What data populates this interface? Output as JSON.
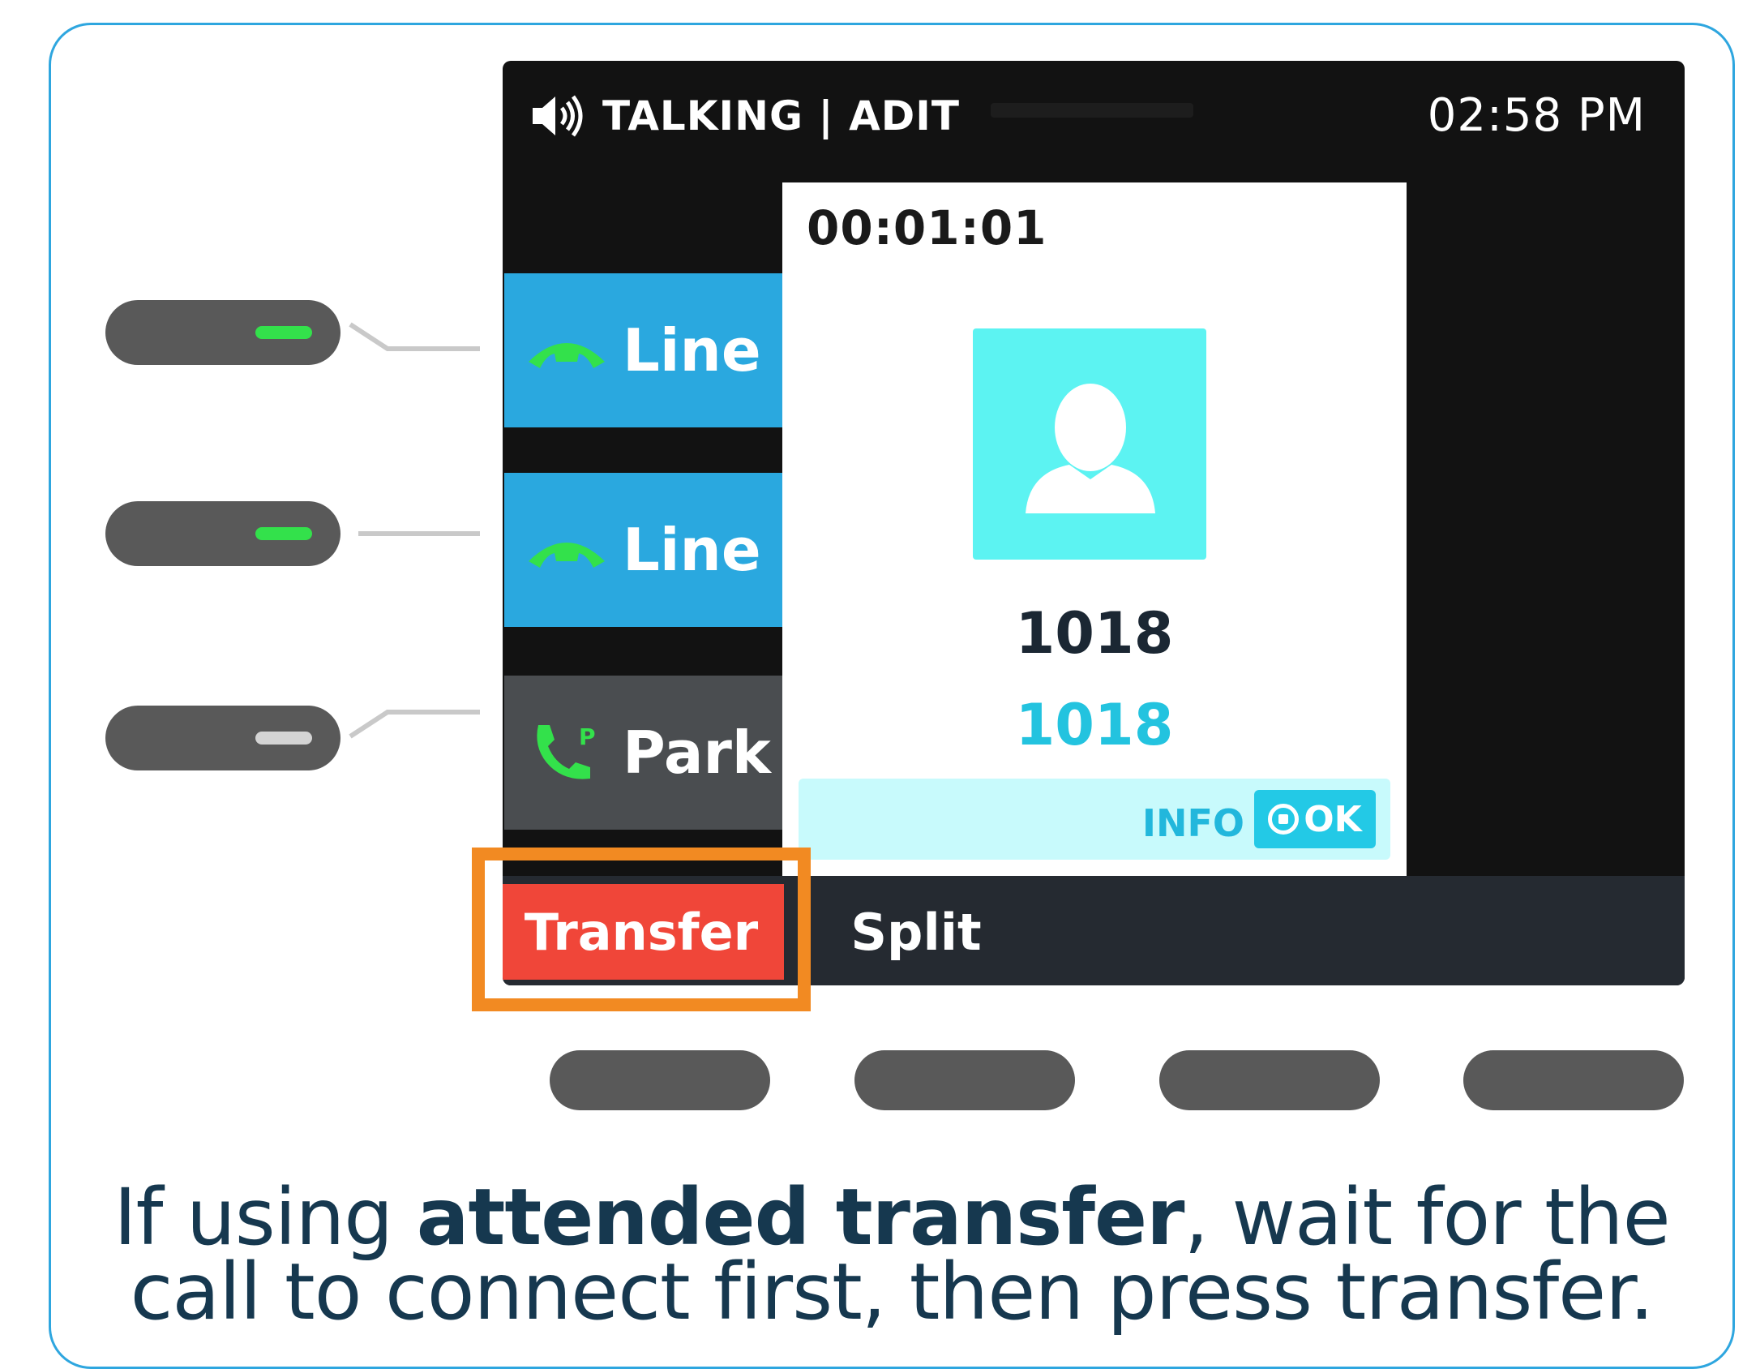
{
  "status": {
    "title": "TALKING | ADIT",
    "time": "02:58 PM"
  },
  "line_keys": [
    {
      "label": "Line",
      "icon": "handset-icon"
    },
    {
      "label": "Line",
      "icon": "handset-icon"
    },
    {
      "label": "Park",
      "icon": "park-call-icon"
    }
  ],
  "popup": {
    "timer": "00:01:01",
    "caller_name": "1018",
    "caller_number": "1018",
    "info_label": "INFO",
    "ok_label": "OK"
  },
  "softkeys": {
    "transfer": "Transfer",
    "split": "Split"
  },
  "caption": {
    "line1_pre": "If using ",
    "line1_bold": "attended transfer",
    "line1_post": ", wait for the",
    "line2": "call to connect first, then press transfer."
  },
  "colors": {
    "accent_blue": "#2aa8df",
    "transfer_red": "#f04639",
    "highlight_orange": "#f28a22",
    "led_green": "#33e14b"
  }
}
